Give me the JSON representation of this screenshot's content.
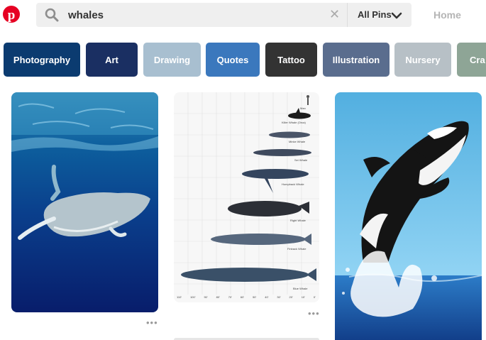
{
  "header": {
    "search_query": "whales",
    "scope_label": "All Pins",
    "home_label": "Home",
    "icons": [
      "pinterest-logo-icon",
      "search-icon",
      "clear-icon",
      "chevron-down-icon"
    ]
  },
  "chips": [
    {
      "label": "Photography",
      "color": "#0b3b70"
    },
    {
      "label": "Art",
      "color": "#1a2f62"
    },
    {
      "label": "Drawing",
      "color": "#a8bfd0"
    },
    {
      "label": "Quotes",
      "color": "#3b78bd"
    },
    {
      "label": "Tattoo",
      "color": "#333333"
    },
    {
      "label": "Illustration",
      "color": "#5a6d8e"
    },
    {
      "label": "Nursery",
      "color": "#b7c0c6"
    },
    {
      "label": "Cra",
      "color": "#8ea596"
    }
  ],
  "size_chart": {
    "species": [
      "Man",
      "Killer Whale (Orca)",
      "Minke Whale",
      "Sei Whale",
      "Humpback Whale",
      "Right Whale",
      "Finback Whale",
      "Blue Whale"
    ],
    "scale_ticks": [
      "110'",
      "100'",
      "90'",
      "80'",
      "70'",
      "60'",
      "50'",
      "40'",
      "30'",
      "20'",
      "10'",
      "0'"
    ]
  },
  "pins": [
    {
      "name": "pin-humpback-whale-underwater",
      "more_label": "•••"
    },
    {
      "name": "pin-whale-size-chart",
      "more_label": "•••"
    },
    {
      "name": "pin-orca-jumping",
      "more_label": ""
    }
  ]
}
